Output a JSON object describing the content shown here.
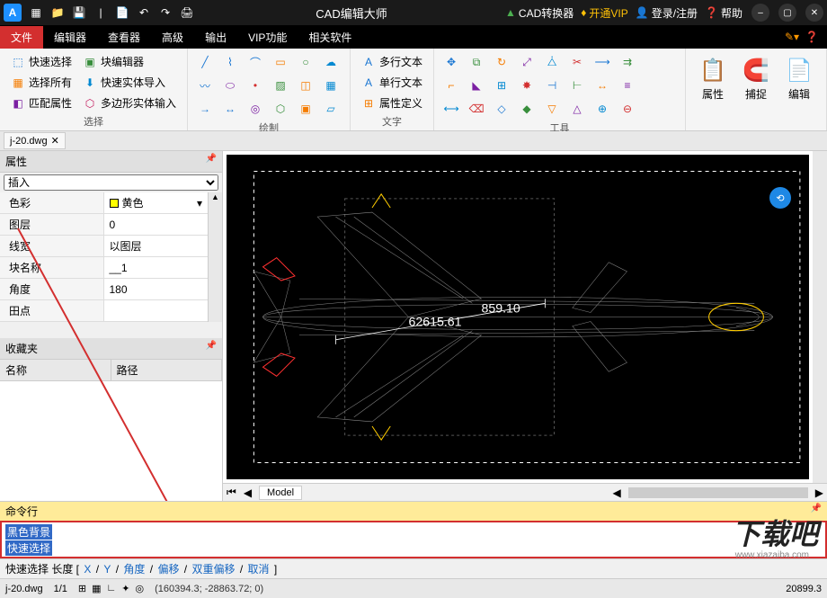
{
  "titlebar": {
    "title": "CAD编辑大师",
    "converter": "CAD转换器",
    "vip": "开通VIP",
    "login": "登录/注册",
    "help": "帮助"
  },
  "menutabs": [
    "文件",
    "编辑器",
    "查看器",
    "高级",
    "输出",
    "VIP功能",
    "相关软件"
  ],
  "menutabs_active": 1,
  "ribbon": {
    "select": {
      "quick": "快速选择",
      "block_editor": "块编辑器",
      "select_all": "选择所有",
      "quick_entity_import": "快速实体导入",
      "match_props": "匹配属性",
      "poly_entity_input": "多边形实体输入",
      "label": "选择"
    },
    "draw": {
      "label": "绘制"
    },
    "text": {
      "multi": "多行文本",
      "single": "单行文本",
      "attr_def": "属性定义",
      "label": "文字"
    },
    "tools": {
      "label": "工具"
    },
    "big": {
      "props": "属性",
      "snap": "捕捉",
      "edit": "编辑"
    }
  },
  "filetab": "j-20.dwg",
  "properties": {
    "header": "属性",
    "insert": "插入",
    "rows": [
      {
        "key": "色彩",
        "val": "黄色",
        "color": true
      },
      {
        "key": "图层",
        "val": "0"
      },
      {
        "key": "线宽",
        "val": "以图层"
      },
      {
        "key": "块名称",
        "val": "__1"
      },
      {
        "key": "角度",
        "val": "180"
      },
      {
        "key": "田点",
        "val": ""
      }
    ]
  },
  "favorites": {
    "header": "收藏夹",
    "col1": "名称",
    "col2": "路径"
  },
  "canvas": {
    "dim1": "62615.61",
    "dim2": "859.10",
    "model_tab": "Model"
  },
  "cmd": {
    "header": "命令行",
    "lines": [
      "黑色背景",
      "快速选择"
    ]
  },
  "status_cmd": {
    "prefix": "快速选择 长度 [ ",
    "links": [
      "X",
      "Y",
      "角度",
      "偏移",
      "双重偏移",
      "取消"
    ],
    "suffix": " ]"
  },
  "statusbar": {
    "file": "j-20.dwg",
    "page": "1/1",
    "coords": "(160394.3; -28863.72; 0)",
    "right": "20899.3"
  },
  "watermark": "下载吧",
  "watermark_url": "www.xiazaiba.com"
}
